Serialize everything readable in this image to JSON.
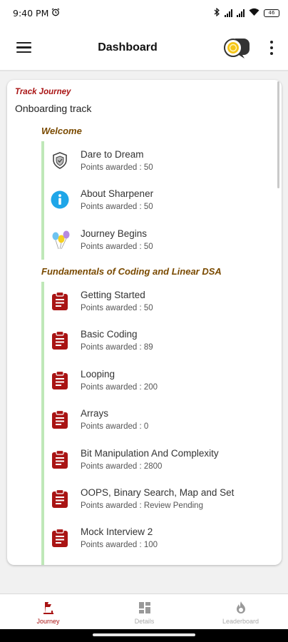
{
  "status_bar": {
    "time": "9:40 PM",
    "battery": "46"
  },
  "app_bar": {
    "title": "Dashboard"
  },
  "track": {
    "label": "Track Journey",
    "name": "Onboarding track",
    "sections": [
      {
        "title": "Welcome",
        "items": [
          {
            "title": "Dare to Dream",
            "points": "Points awarded : 50",
            "icon": "shield-icon"
          },
          {
            "title": "About Sharpener",
            "points": "Points awarded : 50",
            "icon": "info-icon"
          },
          {
            "title": "Journey Begins",
            "points": "Points awarded : 50",
            "icon": "balloons-icon"
          }
        ]
      },
      {
        "title": "Fundamentals of Coding and Linear DSA",
        "items": [
          {
            "title": "Getting Started",
            "points": "Points awarded : 50",
            "icon": "clipboard-icon"
          },
          {
            "title": "Basic Coding",
            "points": "Points awarded : 89",
            "icon": "clipboard-icon"
          },
          {
            "title": "Looping",
            "points": "Points awarded : 200",
            "icon": "clipboard-icon"
          },
          {
            "title": "Arrays",
            "points": "Points awarded : 0",
            "icon": "clipboard-icon"
          },
          {
            "title": "Bit Manipulation And Complexity",
            "points": "Points awarded : 2800",
            "icon": "clipboard-icon"
          },
          {
            "title": "OOPS, Binary Search, Map and Set",
            "points": "Points awarded : Review Pending",
            "icon": "clipboard-icon"
          },
          {
            "title": "Mock Interview 2",
            "points": "Points awarded : 100",
            "icon": "clipboard-icon"
          }
        ]
      }
    ]
  },
  "bottom_nav": [
    {
      "label": "Journey",
      "icon": "journey-icon",
      "active": true
    },
    {
      "label": "Details",
      "icon": "grid-icon",
      "active": false
    },
    {
      "label": "Leaderboard",
      "icon": "flame-icon",
      "active": false
    }
  ],
  "colors": {
    "accent": "#a91414",
    "section_title": "#7a4a00",
    "timeline": "#bfe8b8",
    "info_blue": "#1fa6e8"
  }
}
